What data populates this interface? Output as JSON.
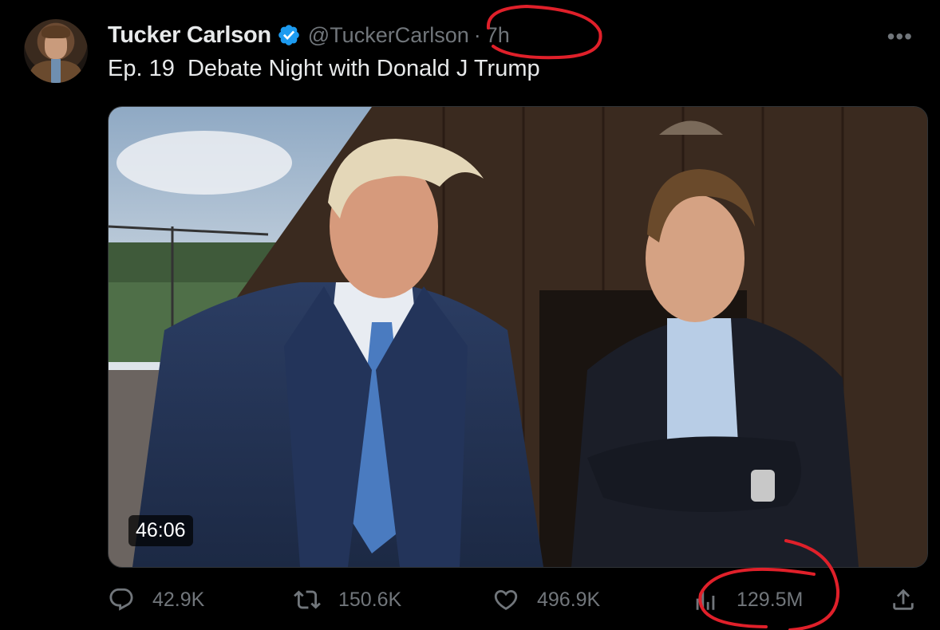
{
  "author": {
    "display_name": "Tucker Carlson",
    "handle": "@TuckerCarlson",
    "separator": "·",
    "time_ago": "7h",
    "verified_color": "#1d9bf0"
  },
  "more_label": "•••",
  "tweet": {
    "text": "Ep. 19  Debate Night with Donald J Trump"
  },
  "media": {
    "duration": "46:06"
  },
  "actions": {
    "replies": "42.9K",
    "retweets": "150.6K",
    "likes": "496.9K",
    "views": "129.5M"
  },
  "icons": {
    "reply": "reply-icon",
    "retweet": "retweet-icon",
    "like": "heart-icon",
    "views": "views-chart-icon",
    "share": "share-icon"
  },
  "colors": {
    "background": "#000000",
    "text": "#e7e9ea",
    "secondary": "#71767b",
    "annotation": "#e0202a"
  }
}
